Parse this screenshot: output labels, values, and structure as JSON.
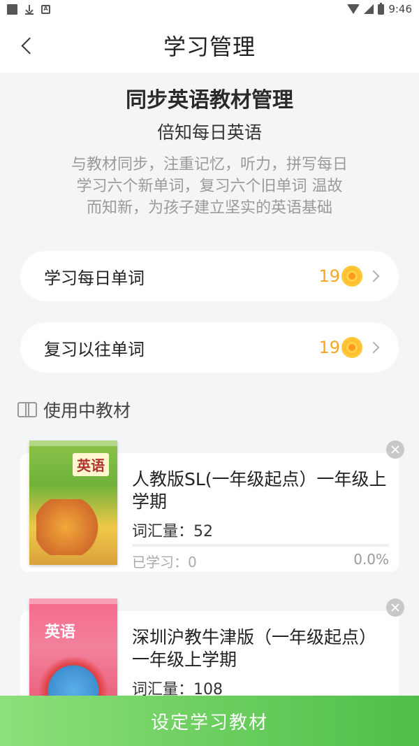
{
  "status_bar": {
    "time": "9:46",
    "left_icons": [
      "square-icon",
      "download-icon",
      "a-icon"
    ],
    "right_icons": [
      "wifi-icon",
      "signal-icon",
      "battery-icon"
    ],
    "a_glyph": "A"
  },
  "header": {
    "title": "学习管理",
    "back_icon": "chevron-left-icon"
  },
  "intro": {
    "title": "同步英语教材管理",
    "subtitle": "倍知每日英语",
    "description": "与教材同步，注重记忆，听力，拼写每日学习六个新单词，复习六个旧单词 温故而知新，为孩子建立坚实的英语基础"
  },
  "actions": [
    {
      "label": "学习每日单词",
      "count": "19",
      "icon": "coin-icon"
    },
    {
      "label": "复习以往单词",
      "count": "19",
      "icon": "coin-icon"
    }
  ],
  "section": {
    "title": "使用中教材",
    "icon": "book-icon"
  },
  "books": [
    {
      "title": "人教版SL(一年级起点）一年级上学期",
      "vocab": "词汇量：52",
      "learned": "已学习：0",
      "percent": "0.0%",
      "progress_fraction": 0.0,
      "cover_label": "英语"
    },
    {
      "title": "深圳沪教牛津版（一年级起点）一年级上学期",
      "vocab": "词汇量：108",
      "cover_label": "英语"
    }
  ],
  "bottom_button": {
    "label": "设定学习教材"
  },
  "colors": {
    "accent_green": "#4fbf4a",
    "coin_orange": "#f5a623",
    "background": "#f4f5f7"
  }
}
